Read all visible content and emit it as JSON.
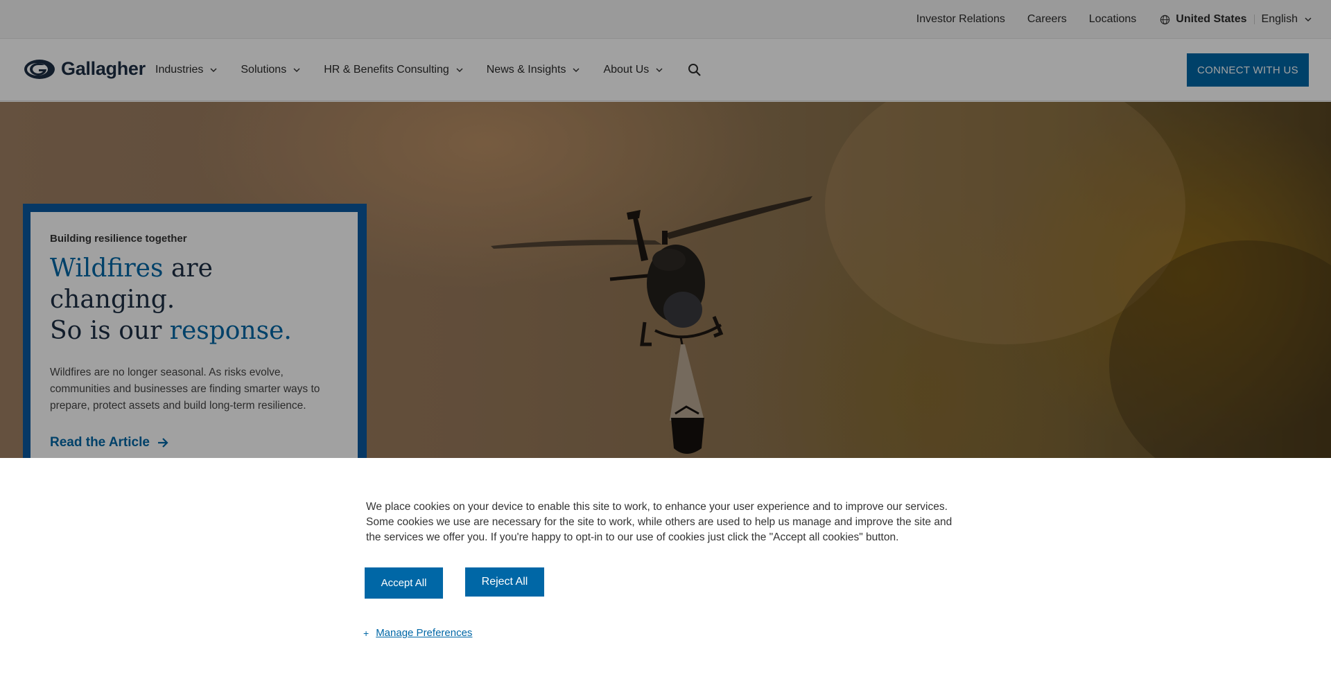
{
  "utility_bar": {
    "links": [
      "Investor Relations",
      "Careers",
      "Locations"
    ],
    "country": "United States",
    "language": "English",
    "globe_icon": "globe-icon"
  },
  "header": {
    "logo_text": "Gallagher",
    "nav": [
      "Industries",
      "Solutions",
      "HR & Benefits Consulting",
      "News & Insights",
      "About Us"
    ],
    "search_icon": "search-icon",
    "connect_label": "CONNECT WITH US"
  },
  "hero": {
    "eyebrow": "Building resilience together",
    "headline_part1": "Wildfires",
    "headline_part2": " are changing.",
    "headline_part3": "So is our ",
    "headline_part4": "response",
    "headline_part5": ".",
    "body": "Wildfires are no longer seasonal. As risks evolve, communities and businesses are finding smarter ways to prepare, protect assets and build long-term resilience.",
    "cta_label": "Read the Article"
  },
  "cookie_banner": {
    "text": "We place cookies on your device to enable this site to work, to enhance your user experience and to improve our services. Some cookies we use are necessary for the site to work, while others are used to help us manage and improve the site and the services we offer you. If you're happy to opt-in to our use of cookies just click the \"Accept all cookies\" button.",
    "accept_label": "Accept All",
    "reject_label": "Reject All",
    "manage_label": "Manage Preferences",
    "manage_icon": "+"
  },
  "colors": {
    "brand_blue": "#0067a6",
    "navy": "#1e2f45",
    "card_border": "#0b5aa0"
  }
}
